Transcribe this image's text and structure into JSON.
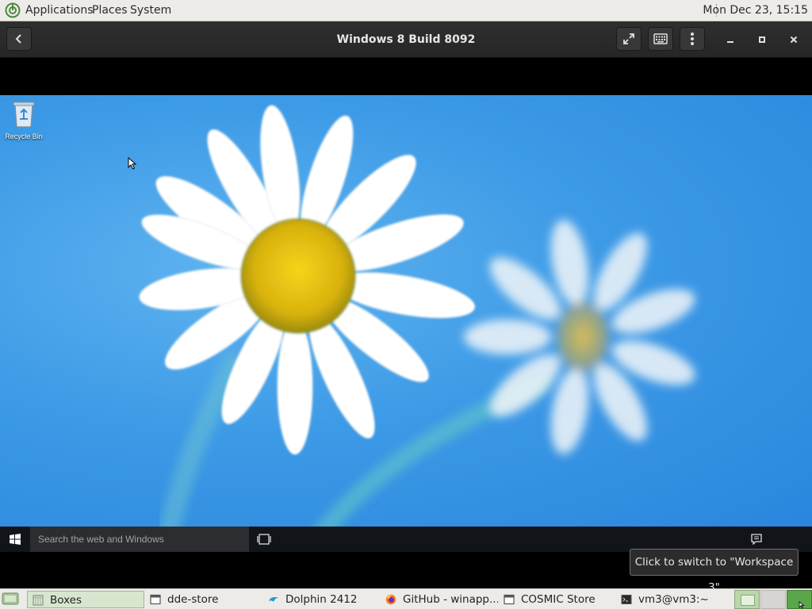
{
  "top_panel": {
    "menus": [
      "Applications",
      "Places",
      "System"
    ],
    "clock": "Mon Dec 23, 15:15"
  },
  "header": {
    "title": "Windows 8 Build 8092",
    "icons": [
      "back-arrow-icon",
      "fullscreen-icon",
      "keyboard-icon",
      "more-options-icon",
      "minimize-icon",
      "maximize-icon",
      "close-icon"
    ]
  },
  "guest": {
    "desktop_icons": [
      {
        "label": "Recycle Bin",
        "icon": "recycle-bin-icon"
      }
    ],
    "taskbar": {
      "search_placeholder": "Search the web and Windows"
    }
  },
  "tooltip": "Click to switch to \"Workspace 3\"",
  "bottom_panel": {
    "tasks": [
      {
        "label": "Boxes",
        "icon": "boxes-icon",
        "active": true
      },
      {
        "label": "dde-store",
        "icon": "window-icon"
      },
      {
        "label": "Dolphin 2412",
        "icon": "dolphin-icon"
      },
      {
        "label": "GitHub - winapp...",
        "icon": "firefox-icon"
      },
      {
        "label": "COSMIC Store",
        "icon": "window-icon"
      },
      {
        "label": "vm3@vm3:~",
        "icon": "terminal-icon"
      }
    ]
  },
  "colors": {
    "desktop_blue": "#3d9ae6",
    "panel": "#edebe8",
    "header": "#2f2f2f",
    "active_workspace": "#5aa64a"
  }
}
